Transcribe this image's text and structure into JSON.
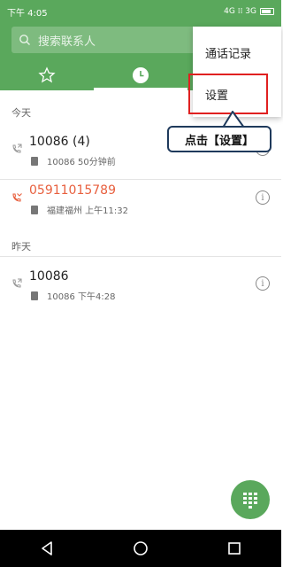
{
  "status_bar": {
    "time": "下午 4:05",
    "network": "4G ⁞⁞ 3G"
  },
  "search": {
    "placeholder": "搜索联系人"
  },
  "tabs": [
    {
      "icon": "star-icon",
      "active": false
    },
    {
      "icon": "clock-icon",
      "active": true
    },
    {
      "icon": "contacts-icon",
      "active": false
    }
  ],
  "sections": {
    "today": "今天",
    "yesterday": "昨天"
  },
  "calls": [
    {
      "name": "10086  (4)",
      "detail": "10086  50分钟前",
      "missed": false
    },
    {
      "name": "05911015789",
      "detail": "福建福州  上午11:32",
      "missed": true
    },
    {
      "name": "10086",
      "detail": "10086  下午4:28",
      "missed": false
    }
  ],
  "menu": {
    "items": [
      "通话记录",
      "设置"
    ]
  },
  "annotation": {
    "text": "点击【设置】"
  },
  "colors": {
    "primary": "#5aa85c",
    "missed": "#e8603f",
    "highlight": "#e02020"
  }
}
